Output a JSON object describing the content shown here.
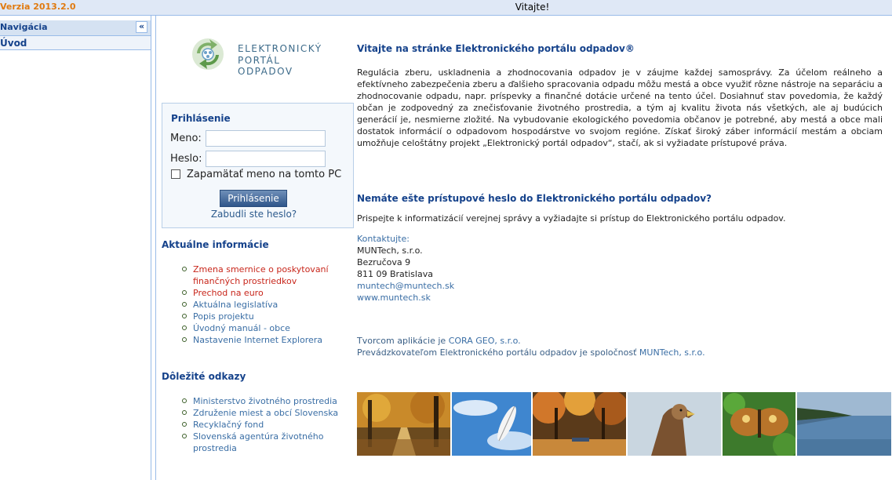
{
  "topbar": {
    "version": "Verzia 2013.2.0",
    "welcome": "Vitajte!"
  },
  "nav": {
    "title": "Navigácia",
    "collapse_icon": "«",
    "items": [
      {
        "label": "Úvod"
      }
    ]
  },
  "logo": {
    "line1": "ELEKTRONICKÝ",
    "line2": "PORTÁL ODPADOV"
  },
  "login": {
    "title": "Prihlásenie",
    "username_label": "Meno:",
    "username_value": "",
    "password_label": "Heslo:",
    "password_value": "",
    "remember_label": "Zapamätať meno na tomto PC",
    "button_label": "Prihlásenie",
    "forgot_link": "Zabudli ste heslo?"
  },
  "news": {
    "title": "Aktuálne informácie",
    "items": [
      {
        "label": "Zmena smernice o poskytovaní finančných prostriedkov",
        "highlight": true
      },
      {
        "label": "Prechod na euro",
        "highlight": true
      },
      {
        "label": "Aktuálna legislatíva",
        "highlight": false
      },
      {
        "label": "Popis projektu",
        "highlight": false
      },
      {
        "label": "Úvodný manuál - obce",
        "highlight": false
      },
      {
        "label": "Nastavenie Internet Explorera",
        "highlight": false
      }
    ]
  },
  "links": {
    "title": "Dôležité odkazy",
    "items": [
      {
        "label": "Ministerstvo životného prostredia"
      },
      {
        "label": "Združenie miest a obcí Slovenska"
      },
      {
        "label": "Recyklačný fond"
      },
      {
        "label": "Slovenská agentúra životného prostredia"
      }
    ]
  },
  "content": {
    "welcome_heading": "Vitajte na stránke Elektronického portálu odpadov®",
    "intro": "Regulácia zberu, uskladnenia a zhodnocovania odpadov je v záujme každej samosprávy. Za účelom reálneho a efektívneho zabezpečenia zberu a ďalšieho spracovania odpadu môžu mestá a obce využiť rôzne nástroje na separáciu a zhodnocovanie odpadu, napr. príspevky a finančné dotácie určené na tento účel. Dosiahnuť stav povedomia, že každý občan je zodpovedný za znečisťovanie životného prostredia, a tým aj kvalitu života nás všetkých, ale aj budúcich generácií je, nesmierne zložité. Na vybudovanie ekologického povedomia občanov je potrebné, aby mestá a obce mali dostatok informácií o odpadovom hospodárstve vo svojom regióne. Získať široký záber informácií mestám a obciam umožňuje celoštátny projekt „Elektronický portál odpadov“, stačí, ak si vyžiadate prístupové práva.",
    "access_heading": "Nemáte ešte prístupové heslo do Elektronického portálu odpadov?",
    "access_text": "Prispejte k informatizácií verejnej správy a vyžiadajte si prístup do Elektronického portálu odpadov.",
    "contact": {
      "label": "Kontaktujte:",
      "company": "MUNTech, s.r.o.",
      "street": "Bezručova 9",
      "city": "811 09 Bratislava",
      "email": "muntech@muntech.sk",
      "web": "www.muntech.sk"
    },
    "credits": {
      "author_prefix": "Tvorcom aplikácie je",
      "author_link": "CORA GEO, s.r.o.",
      "operator_prefix": "Prevádzkovateľom Elektronického portálu odpadov je spoločnosť",
      "operator_link": "MUNTech, s.r.o."
    }
  },
  "photos": [
    {
      "name": "autumn-forest-path"
    },
    {
      "name": "feather-sky"
    },
    {
      "name": "autumn-park-bench"
    },
    {
      "name": "eagle"
    },
    {
      "name": "butterfly"
    },
    {
      "name": "lake-shore"
    }
  ],
  "colors": {
    "accent": "#15428b",
    "link": "#3a6ea5",
    "alert": "#c8261b",
    "version": "#e07a10",
    "panel_border": "#99bbe8"
  }
}
